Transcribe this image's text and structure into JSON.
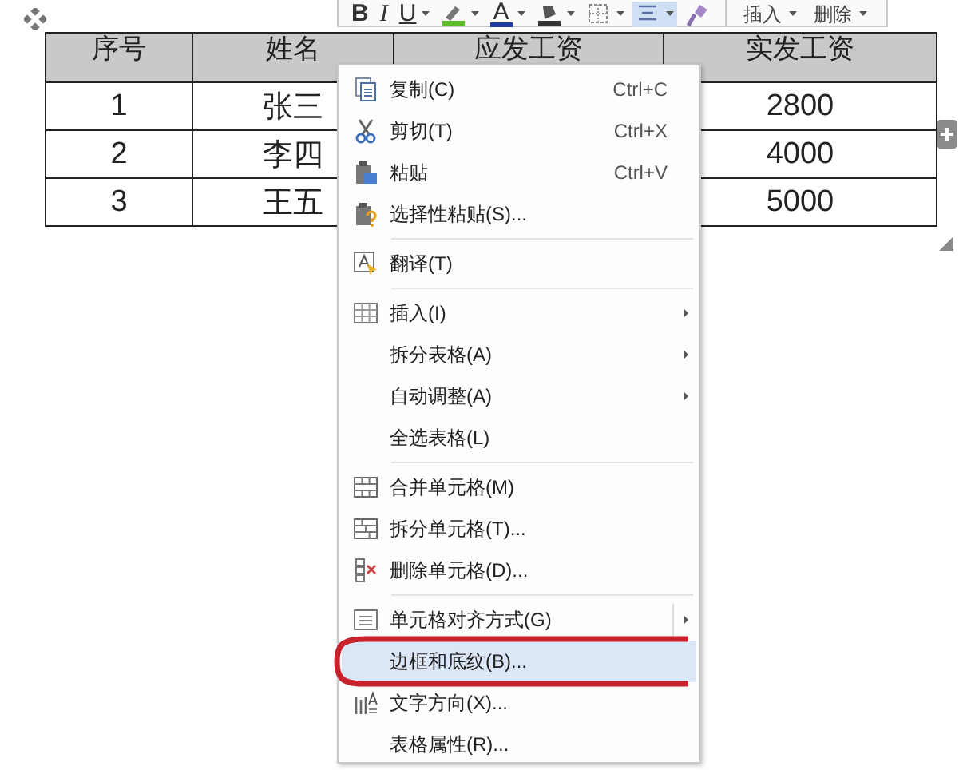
{
  "toolbar": {
    "tools": [
      {
        "kind": "bold",
        "label": "B",
        "dropdown": false,
        "selected": false
      },
      {
        "kind": "italic",
        "label": "I",
        "dropdown": false,
        "selected": false
      },
      {
        "kind": "underline",
        "label": "U",
        "dropdown": true,
        "selected": false
      },
      {
        "kind": "highlight",
        "dropdown": true,
        "selected": false
      },
      {
        "kind": "font-color",
        "label": "A",
        "dropdown": true,
        "selected": false
      },
      {
        "kind": "shading",
        "dropdown": true,
        "selected": false
      },
      {
        "kind": "borders",
        "dropdown": true,
        "selected": false
      },
      {
        "kind": "align",
        "dropdown": true,
        "selected": true
      },
      {
        "kind": "painter",
        "dropdown": false,
        "selected": false
      }
    ],
    "buttons": [
      {
        "label": "插入",
        "dropdown": true
      },
      {
        "label": "删除",
        "dropdown": true
      }
    ]
  },
  "table": {
    "columns": [
      "序号",
      "姓名",
      "应发工资",
      "实发工资"
    ],
    "rows": [
      {
        "number": "1",
        "name": "张三",
        "actual_pay": "2800"
      },
      {
        "number": "2",
        "name": "李四",
        "actual_pay": "4000"
      },
      {
        "number": "3",
        "name": "王五",
        "actual_pay": "5000"
      }
    ]
  },
  "context_menu": {
    "groups": [
      [
        {
          "label": "复制(C)",
          "kind": "copy",
          "shortcut": "Ctrl+C",
          "submenu": false,
          "selected": false
        },
        {
          "label": "剪切(T)",
          "kind": "scissors",
          "shortcut": "Ctrl+X",
          "submenu": false,
          "selected": false
        },
        {
          "label": "粘贴",
          "kind": "paste",
          "shortcut": "Ctrl+V",
          "submenu": false,
          "selected": false
        },
        {
          "label": "选择性粘贴(S)...",
          "kind": "paste-special",
          "submenu": false,
          "selected": false
        }
      ],
      [
        {
          "label": "翻译(T)",
          "kind": "translate",
          "submenu": false,
          "selected": false
        }
      ],
      [
        {
          "label": "插入(I)",
          "kind": "grid",
          "submenu": true,
          "selected": false
        },
        {
          "label": "拆分表格(A)",
          "kind": "plain",
          "submenu": true,
          "selected": false
        },
        {
          "label": "自动调整(A)",
          "kind": "plain",
          "submenu": true,
          "selected": false
        },
        {
          "label": "全选表格(L)",
          "kind": "plain",
          "submenu": false,
          "selected": false
        }
      ],
      [
        {
          "label": "合并单元格(M)",
          "kind": "merge",
          "submenu": false,
          "selected": false
        },
        {
          "label": "拆分单元格(T)...",
          "kind": "split",
          "submenu": false,
          "selected": false
        },
        {
          "label": "删除单元格(D)...",
          "kind": "delete-cells",
          "submenu": false,
          "selected": false
        }
      ],
      [
        {
          "label": "单元格对齐方式(G)",
          "kind": "align",
          "submenu": true,
          "selected": false
        },
        {
          "label": "边框和底纹(B)...",
          "kind": "plain",
          "submenu": false,
          "selected": true
        },
        {
          "label": "文字方向(X)...",
          "kind": "text-direction",
          "submenu": false,
          "selected": false
        },
        {
          "label": "表格属性(R)...",
          "kind": "plain",
          "submenu": false,
          "selected": false
        }
      ]
    ]
  }
}
